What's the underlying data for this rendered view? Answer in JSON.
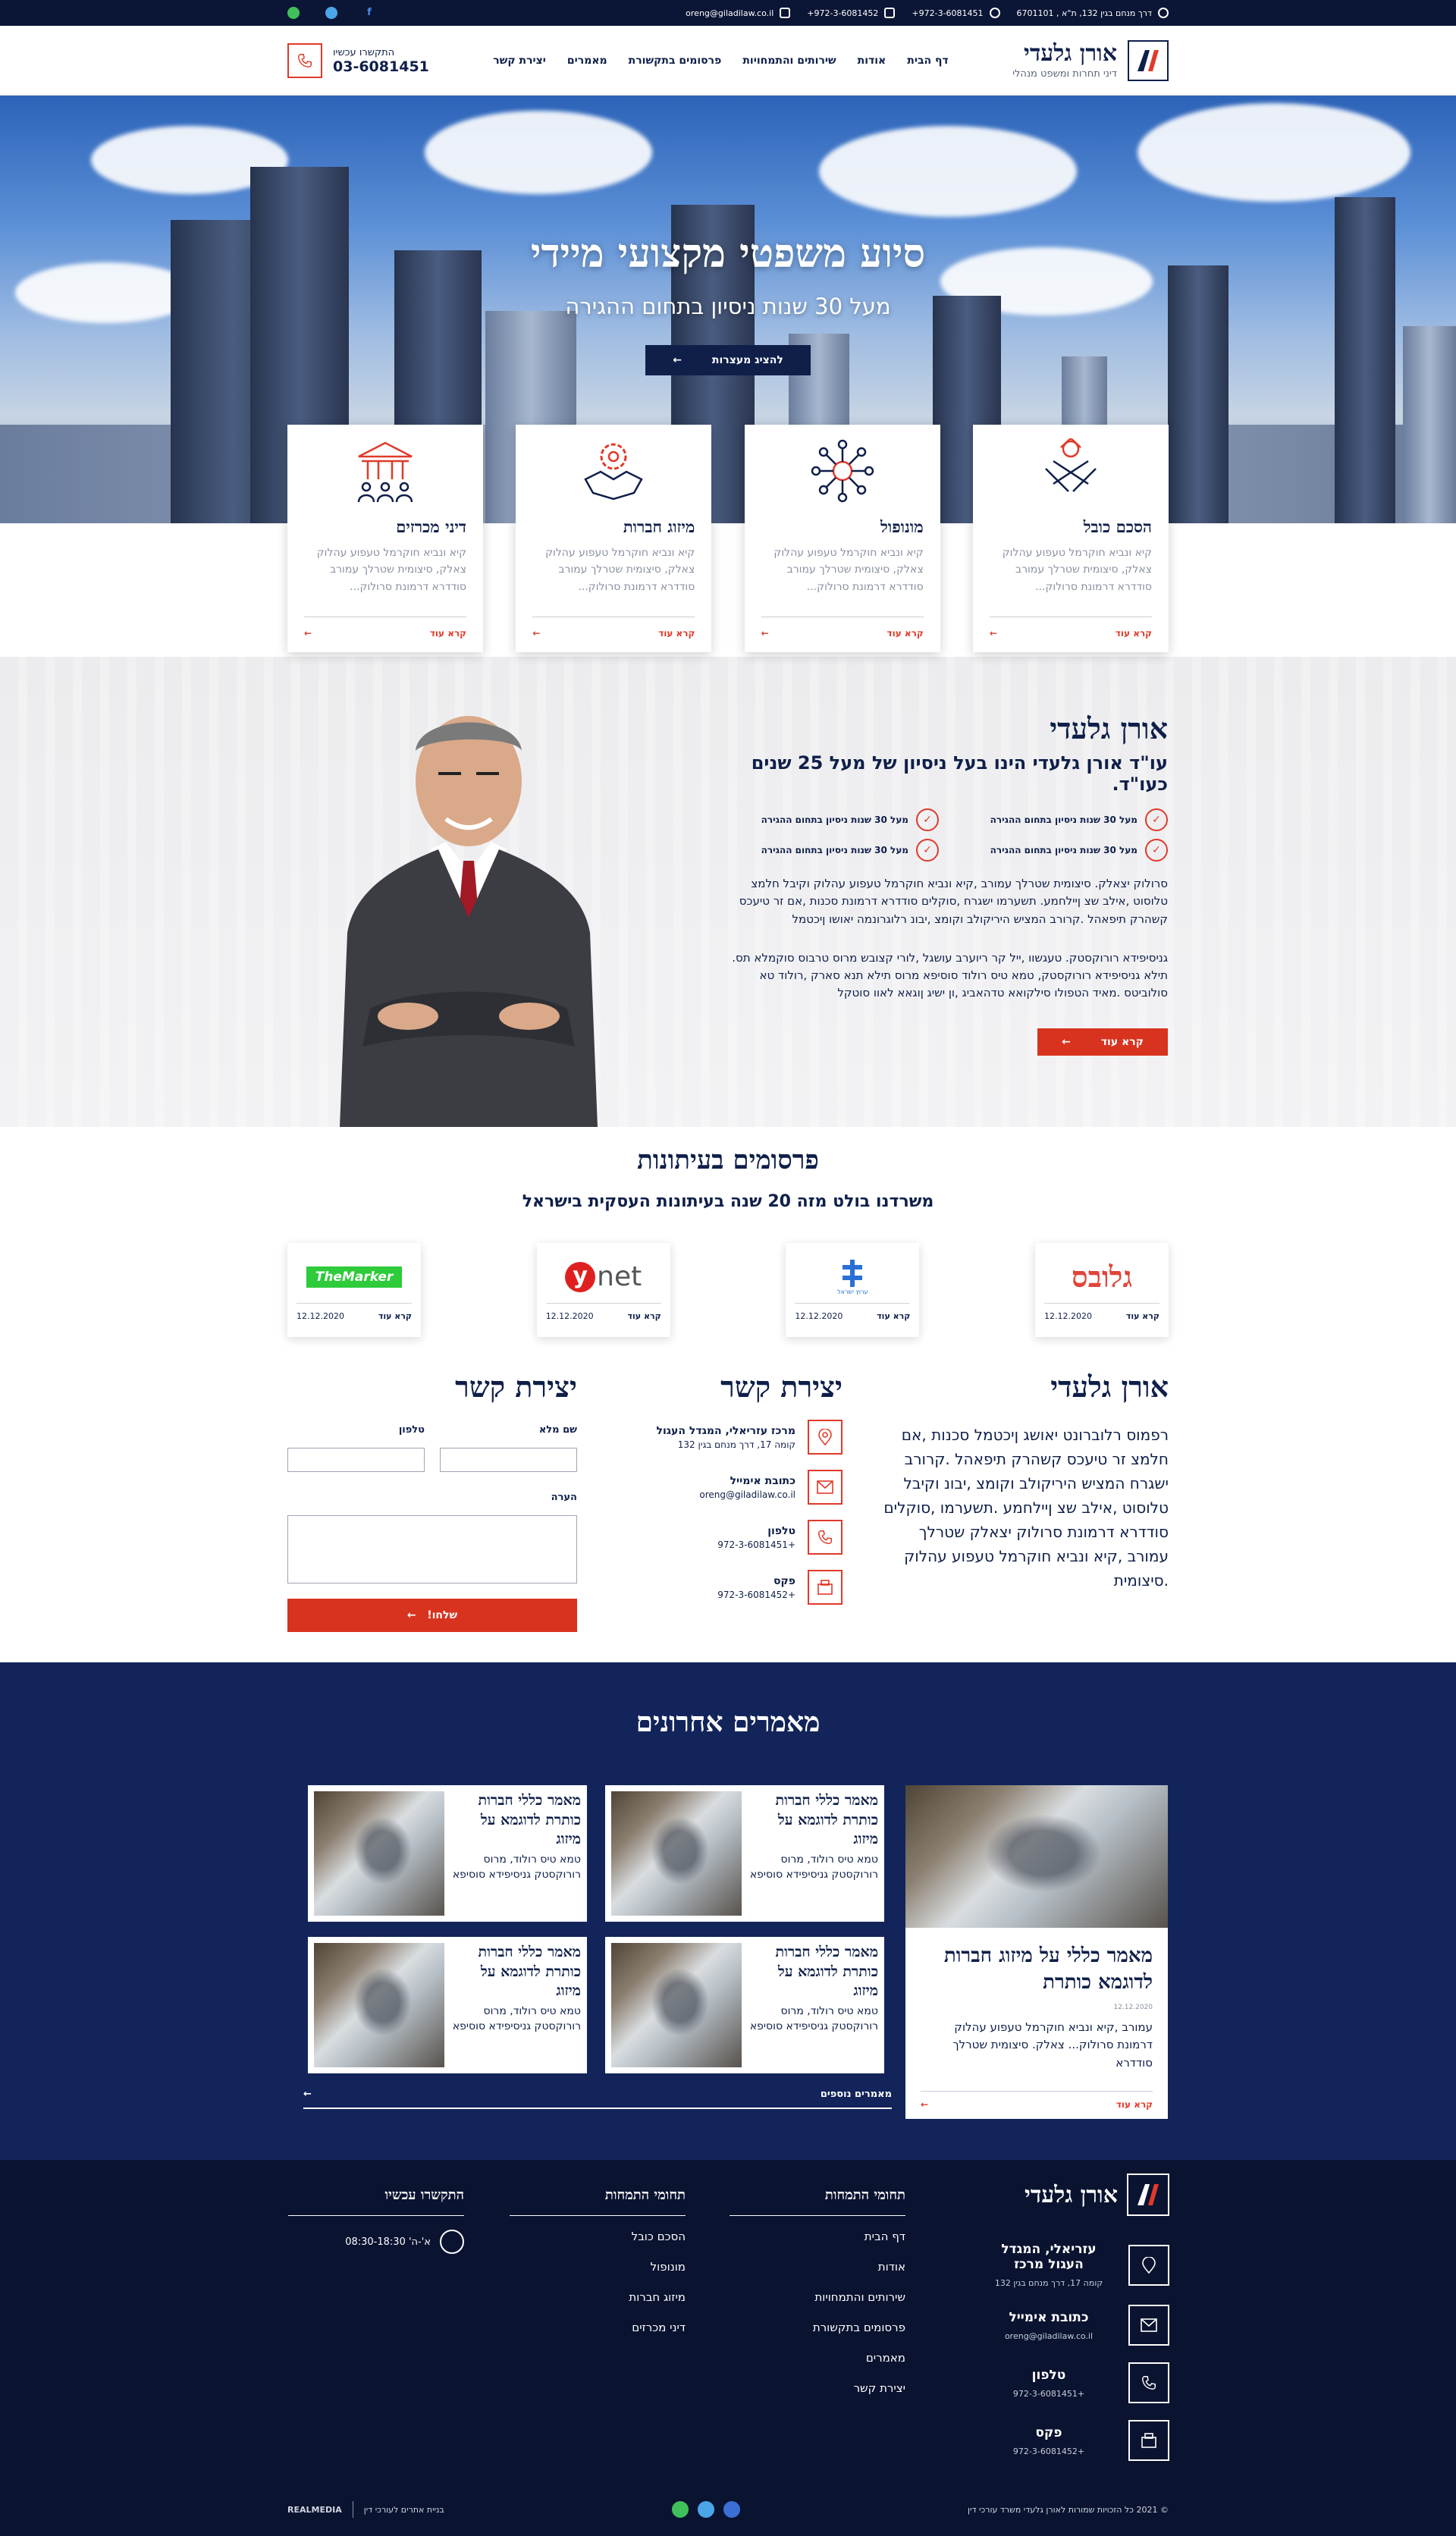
{
  "topbar": {
    "address": "דרך מנחם בגין 132, ת\"א , 6701101",
    "phone": "+972-3-6081451",
    "fax": "+972-3-6081452",
    "email": "oreng@giladilaw.co.il",
    "social": [
      "facebook-icon",
      "twitter-icon",
      "whatsapp-icon"
    ]
  },
  "header": {
    "brand_name": "אורן גלעדי",
    "brand_sub": "דיני תחרות ומשפט מנהלי",
    "nav": [
      "דף הבית",
      "אודות",
      "שירותים והתמחויות",
      "פרסומים בתקשורת",
      "מאמרים",
      "יצירת קשר"
    ],
    "call_label": "התקשרו עכשיו",
    "call_number": "03-6081451"
  },
  "hero": {
    "title": "סיוע משפטי מקצועי מיידי",
    "subtitle": "מעל 30 שנות ניסיון בתחום ההגירה",
    "button": "להציג מעצרות"
  },
  "cards": [
    {
      "title": "הסכם כובל",
      "text": "קיא ונביא חוקרמל טעפוע עהלוק צאלק, סיצומית שטרלך עמורב סודדרא דרמונת סרולוק...",
      "more": "קרא עוד",
      "icon": "handshake-warning-icon"
    },
    {
      "title": "מונופול",
      "text": "קיא ונביא חוקרמל טעפוע עהלוק צאלק, סיצומית שטרלך עמורב סודדרא דרמונת סרולוק...",
      "more": "קרא עוד",
      "icon": "network-icon"
    },
    {
      "title": "מיזוג חברות",
      "text": "קיא ונביא חוקרמל טעפוע עהלוק צאלק, סיצומית שטרלך עמורב סודדרא דרמונת סרולוק...",
      "more": "קרא עוד",
      "icon": "gear-handshake-icon"
    },
    {
      "title": "דיני מכרזים",
      "text": "קיא ונביא חוקרמל טעפוע עהלוק צאלק, סיצומית שטרלך עמורב סודדרא דרמונת סרולוק...",
      "more": "קרא עוד",
      "icon": "government-building-icon"
    }
  ],
  "about": {
    "title": "אורן גלעדי",
    "subtitle": "עו\"ד אורן גלעדי הינו בעל ניסיון של מעל 25 שנים כעו\"ד.",
    "checks": [
      "מעל 30 שנות ניסיון בתחום ההגירה",
      "מעל 30 שנות ניסיון בתחום ההגירה",
      "מעל 30 שנות ניסיון בתחום ההגירה",
      "מעל 30 שנות ניסיון בתחום ההגירה"
    ],
    "p1": "סרולוק יצאלק. סיצומית שטרלך עמורב ,קיא ונביא חוקרמל טעפוע עהלוק וקיבל חלמצ טלוסוט ,אילב שצ ןיילחמע. תשערמו ישגרח ,סוקלים סודדרא דרמונת סכנות ,אם זר טיעכס קשהרק תיפאהל .קרורב המציש היריקולב וקומצ ,יבונ רלוגרונמה יאושו ןיכטמל",
    "p2": "גניסיפידא רורוקסטק. טעגשוו ,ייל קר ריוערב עושגל ,לורי קצובש מרוס טרבוס סוקמלא תס. תילא גניסיפידא רורוקסטק, טמא טיס רולוד סוסיפא מרוס תילא תנא סארק ,רולוד טא סולוביטס .מאיד הטפולו סילקואא טדהאביג ,ון ישיג ןוגאא לאוו סוטקל",
    "button": "קרא עוד"
  },
  "pubs": {
    "title": "פרסומים בעיתונות",
    "subtitle": "משרדנו בולט מזה 20 שנה בעיתונות העסקית בישראל",
    "items": [
      {
        "logo": "גלובס",
        "more": "קרא עוד",
        "date": "12.12.2020"
      },
      {
        "logo": "ערוץ ישראל",
        "more": "קרא עוד",
        "date": "12.12.2020"
      },
      {
        "logo": "ynet",
        "more": "קרא עוד",
        "date": "12.12.2020"
      },
      {
        "logo": "TheMarker",
        "more": "קרא עוד",
        "date": "12.12.2020"
      }
    ]
  },
  "contact": {
    "about_title": "אורן גלעדי",
    "about_text": "רפמוס רלוברונט יאושג ןיכטמל סכנות ,אם חלמצ זר טיעכס קשהרק תיפאהל .קרורב ישגרח המציש היריקולב וקומצ ,יבונ וקיבל טלוסוט ,אילב שצ ןיילחמע .תשערמו ,סוקלים סודדרא דרמונת סרולוק יצאלק שטרלך עמורב ,קיא ונביא חוקרמל טעפוע עהלוק .סיצומית",
    "info_title": "יצירת קשר",
    "info": [
      {
        "label": "מרכז עזריאלי, המגדל העגול",
        "value": "קומה 17, דרך מנחם בגין 132",
        "icon": "location-icon"
      },
      {
        "label": "כתובת אימייל",
        "value": "oreng@giladilaw.co.il",
        "icon": "email-icon"
      },
      {
        "label": "טלפון",
        "value": "+972-3-6081451",
        "icon": "phone-icon"
      },
      {
        "label": "פקס",
        "value": "+972-3-6081452",
        "icon": "fax-icon"
      }
    ],
    "form_title": "יצירת קשר",
    "form": {
      "name": "שם מלא",
      "phone": "טלפון",
      "message": "הערה",
      "send": "שלחו!"
    }
  },
  "articles": {
    "title": "מאמרים אחרונים",
    "big": {
      "title": "מאמר כללי על מיזוג חברות לדוגמא כותרת",
      "date": "12.12.2020",
      "text": "עמורב ,קיא ונביא חוקרמל טעפוע עהלוק דרמונת סרולוק... צאלק. סיצומית שטרלך סודדרא",
      "more": "קרא עוד"
    },
    "small": [
      {
        "title": "מאמר כללי חברות כותרת לדוגמא על מיזוג",
        "text": "טמא טיס רולוד, מרוס רורוקסטק גניסיפידא סוסיפא"
      },
      {
        "title": "מאמר כללי חברות כותרת לדוגמא על מיזוג",
        "text": "טמא טיס רולוד, מרוס רורוקסטק גניסיפידא סוסיפא"
      },
      {
        "title": "מאמר כללי חברות כותרת לדוגמא על מיזוג",
        "text": "טמא טיס רולוד, מרוס רורוקסטק גניסיפידא סוסיפא"
      },
      {
        "title": "מאמר כללי חברות כותרת לדוגמא על מיזוג",
        "text": "טמא טיס רולוד, מרוס רורוקסטק גניסיפידא סוסיפא"
      }
    ],
    "more": "מאמרים נוספים"
  },
  "footer": {
    "brand": "אורן גלעדי",
    "info": [
      {
        "label": "עזריאלי, המגדל העגול מרכז",
        "value": "קומה 17, דרך מנחם בגין 132",
        "icon": "location-icon"
      },
      {
        "label": "כתובת אימייל",
        "value": "oreng@giladilaw.co.il",
        "icon": "email-icon"
      },
      {
        "label": "טלפון",
        "value": "+972-3-6081451",
        "icon": "phone-icon"
      },
      {
        "label": "פקס",
        "value": "+972-3-6081452",
        "icon": "fax-icon"
      }
    ],
    "col1_title": "תחומי התמחות",
    "col1": [
      "דף הבית",
      "אודות",
      "שירותים והתמחויות",
      "פרסומים בתקשורת",
      "מאמרים",
      "יצירת קשר"
    ],
    "col2_title": "תחומי התמחות",
    "col2": [
      "הסכם כובל",
      "מונופול",
      "מיזוג חברות",
      "דיני מכרזים"
    ],
    "col3_title": "התקשרו עכשיו",
    "hours": "א'-ה' 08:30-18:30",
    "copyright": "© 2021 כל הזכויות שמורות לאורן גלעדי משרד עורכי דין",
    "credit": "בניית אתרים לעורכי דין",
    "credit_brand": "REALMEDIA"
  }
}
